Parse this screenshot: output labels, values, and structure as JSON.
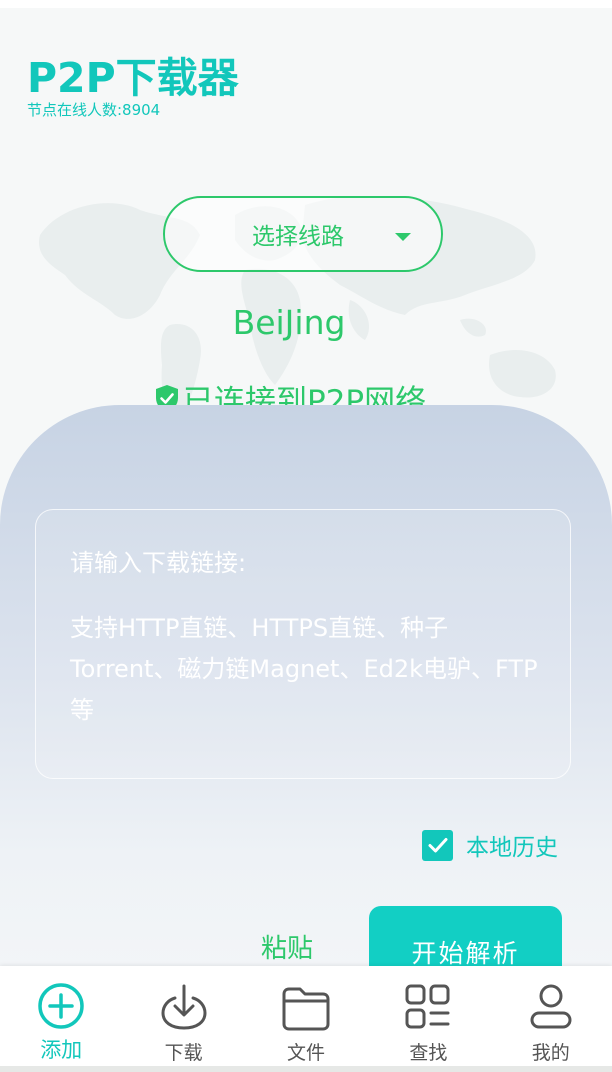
{
  "app": {
    "title": "P2P下载器",
    "online_count": "节点在线人数:8904"
  },
  "route": {
    "select_label": "选择线路",
    "city": "BeiJing",
    "status": "已连接到P2P网络"
  },
  "download": {
    "input_placeholder": "请输入下载链接:",
    "support_text": " 支持HTTP直链、HTTPS直链、种子Torrent、磁力链Magnet、Ed2k电驴、FTP等",
    "history_label": "本地历史",
    "history_checked": true,
    "paste_label": "粘贴",
    "parse_label": "开始解析"
  },
  "nav": {
    "items": [
      {
        "label": "添加",
        "icon": "add-circle-icon",
        "active": true
      },
      {
        "label": "下载",
        "icon": "download-icon",
        "active": false
      },
      {
        "label": "文件",
        "icon": "folder-icon",
        "active": false
      },
      {
        "label": "查找",
        "icon": "grid-search-icon",
        "active": false
      },
      {
        "label": "我的",
        "icon": "user-icon",
        "active": false
      }
    ]
  },
  "colors": {
    "accent_teal": "#12c7bb",
    "accent_green": "#2dc86b",
    "panel_top": "#c7d3e4"
  }
}
